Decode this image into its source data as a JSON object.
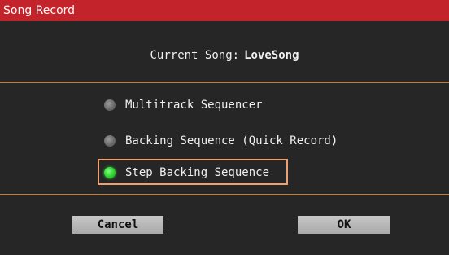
{
  "window": {
    "title": "Song Record"
  },
  "current_song": {
    "label": "Current Song:",
    "name": "LoveSong"
  },
  "options": [
    {
      "label": "Multitrack Sequencer",
      "selected": false
    },
    {
      "label": "Backing Sequence (Quick Record)",
      "selected": false
    },
    {
      "label": "Step Backing Sequence",
      "selected": true
    }
  ],
  "buttons": {
    "cancel_label": "Cancel",
    "ok_label": "OK"
  },
  "colors": {
    "title_bar": "#c3242b",
    "background": "#262626",
    "divider": "#c8802e",
    "selection_frame": "#f0a070",
    "radio_selected": "#2fd02f",
    "radio_unselected": "#6a6a6a",
    "button": "#bcbcbc"
  }
}
